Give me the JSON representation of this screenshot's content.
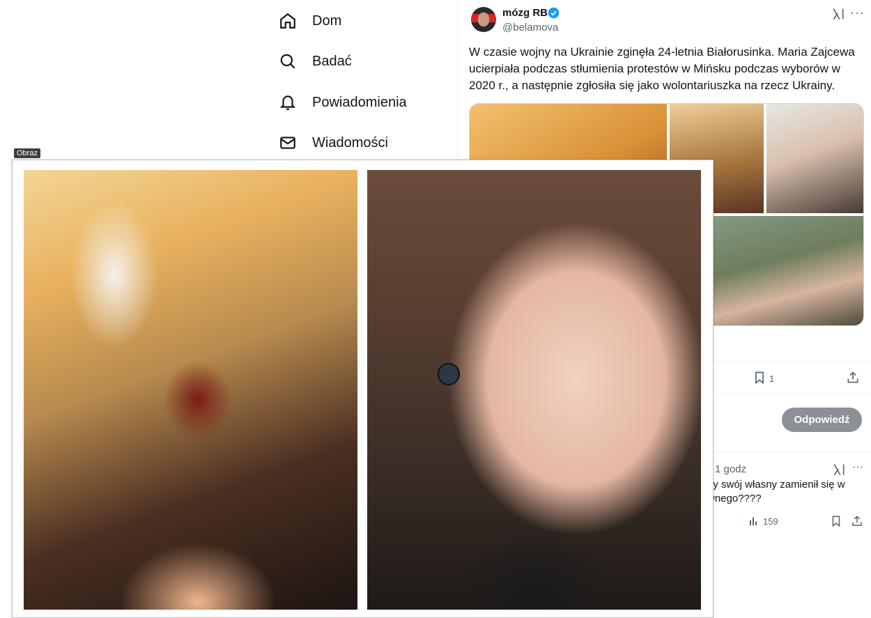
{
  "nav": {
    "items": [
      {
        "label": "Dom",
        "icon": "home-icon"
      },
      {
        "label": "Badać",
        "icon": "search-icon"
      },
      {
        "label": "Powiadomienia",
        "icon": "bell-icon"
      },
      {
        "label": "Wiadomości",
        "icon": "mail-icon"
      }
    ]
  },
  "tweet": {
    "author_name": "mózg RB",
    "handle": "@belamova",
    "text": "W czasie wojny na Ukrainie zginęła 24-letnia Białorusinka. Maria Zajcewa ucierpiała podczas stłumienia protestów w Mińsku podczas wyborów w 2020 r., a następnie zgłosiła się jako wolontariuszka na rzecz Ukrainy.",
    "bookmark_count": "1",
    "verified_color": "#1d9bf0"
  },
  "reply_composer": {
    "button_label": "Odpowiedź",
    "button_color": "#8b9196"
  },
  "reply": {
    "time": "1 godz",
    "text_line1": "dy swój własny zamienił się w",
    "text_line2": "wnego????",
    "views": "159"
  },
  "overlay": {
    "tag": "Obraz"
  }
}
